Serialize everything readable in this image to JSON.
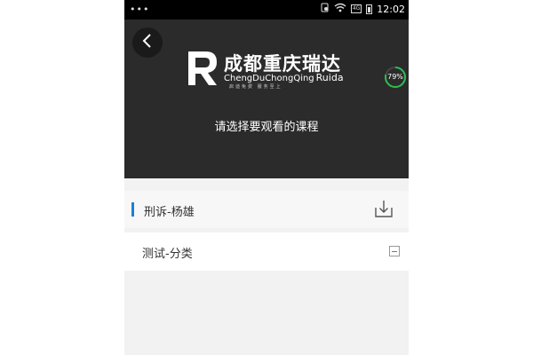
{
  "status_bar": {
    "dots": "•••",
    "time": "12:02",
    "sim_label": "4G"
  },
  "header": {
    "logo": {
      "name_cn": "成都重庆瑞达",
      "name_en_1": "ChengDuChongQing",
      "name_en_2": "Ruida",
      "slogan": "启迪免费 服务至上"
    },
    "progress_percent": 79,
    "progress_label": "79%",
    "prompt": "请选择要观看的课程"
  },
  "course_section": {
    "title": "刑诉-杨雄"
  },
  "category": {
    "label": "测试-分类"
  },
  "colors": {
    "accent": "#1e7fd6",
    "progress_ring": "#2ebd4f",
    "hero_bg": "#2b2b2b"
  },
  "icons": [
    "back-icon",
    "download-icon",
    "collapse-icon",
    "wifi-icon",
    "battery-icon"
  ]
}
